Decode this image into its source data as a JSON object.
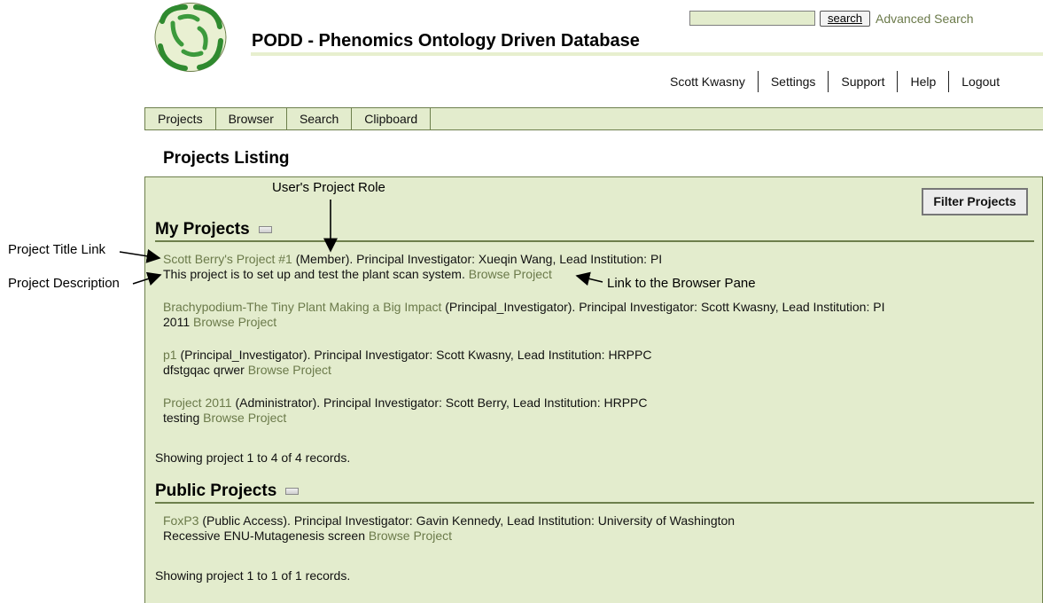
{
  "header": {
    "title": "PODD - Phenomics Ontology Driven Database",
    "search_value": "",
    "search_button": "search",
    "advanced_search": "Advanced Search"
  },
  "user_menu": [
    "Scott Kwasny",
    "Settings",
    "Support",
    "Help",
    "Logout"
  ],
  "tabs": [
    "Projects",
    "Browser",
    "Search",
    "Clipboard"
  ],
  "page": {
    "title": "Projects Listing",
    "filter_button": "Filter Projects"
  },
  "my_projects": {
    "heading": "My Projects",
    "projects": [
      {
        "title": "Scott Berry's Project #1",
        "meta": " (Member). Principal Investigator: Xueqin Wang, Lead Institution: PI",
        "description": "This project is to set up and test the plant scan system.",
        "browse": "Browse Project"
      },
      {
        "title": "Brachypodium-The Tiny Plant Making a Big Impact",
        "meta": " (Principal_Investigator). Principal Investigator: Scott Kwasny, Lead Institution: PI",
        "description": "2011",
        "browse": "Browse Project"
      },
      {
        "title": "p1",
        "meta": " (Principal_Investigator). Principal Investigator: Scott Kwasny, Lead Institution: HRPPC",
        "description": "dfstgqac qrwer",
        "browse": "Browse Project"
      },
      {
        "title": "Project 2011",
        "meta": " (Administrator). Principal Investigator: Scott Berry, Lead Institution: HRPPC",
        "description": "testing",
        "browse": "Browse Project"
      }
    ],
    "records": "Showing project 1 to 4 of 4 records."
  },
  "public_projects": {
    "heading": "Public Projects",
    "projects": [
      {
        "title": "FoxP3",
        "meta": " (Public Access). Principal Investigator: Gavin Kennedy, Lead Institution: University of Washington",
        "description": "Recessive ENU-Mutagenesis screen",
        "browse": "Browse Project"
      }
    ],
    "records": "Showing project 1 to 1 of 1 records."
  },
  "annotations": {
    "project_title_link": "Project Title Link",
    "project_description": "Project Description",
    "users_project_role": "User's Project Role",
    "link_to_browser": "Link to the Browser Pane"
  },
  "colors": {
    "panel_bg": "#e3eccd",
    "border": "#6d7f4c",
    "link": "#6b7a4a"
  }
}
